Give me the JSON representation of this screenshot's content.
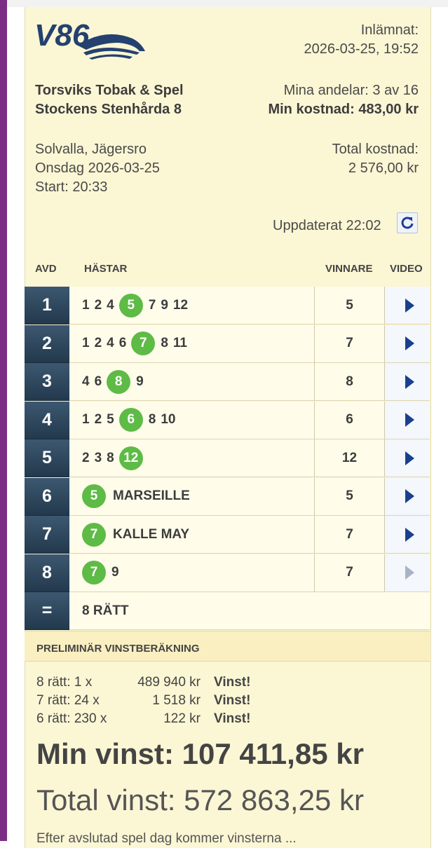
{
  "header": {
    "logo_text": "V86",
    "submitted_label": "Inlämnat:",
    "submitted_time": "2026-03-25, 19:52",
    "store_name": "Torsviks Tobak & Spel",
    "team_name": "Stockens Stenhårda 8",
    "shares": "Mina andelar: 3 av 16",
    "my_cost": "Min kostnad: 483,00 kr",
    "tracks": "Solvalla, Jägersro",
    "date": "Onsdag 2026-03-25",
    "start": "Start: 20:33",
    "total_cost_label": "Total kostnad:",
    "total_cost_value": "2 576,00 kr",
    "updated": "Uppdaterat 22:02",
    "refresh_icon": "refresh-icon"
  },
  "table": {
    "columns": {
      "avd": "AVD",
      "horses": "HÄSTAR",
      "winner": "VINNARE",
      "video": "VIDEO"
    },
    "rows": [
      {
        "avd": "1",
        "before": [
          "1",
          "2",
          "4"
        ],
        "winner_mark": "5",
        "after": [
          "7",
          "9",
          "12"
        ],
        "name": "",
        "winner": "5",
        "video_active": true
      },
      {
        "avd": "2",
        "before": [
          "1",
          "2",
          "4",
          "6"
        ],
        "winner_mark": "7",
        "after": [
          "8",
          "11"
        ],
        "name": "",
        "winner": "7",
        "video_active": true
      },
      {
        "avd": "3",
        "before": [
          "4",
          "6"
        ],
        "winner_mark": "8",
        "after": [
          "9"
        ],
        "name": "",
        "winner": "8",
        "video_active": true
      },
      {
        "avd": "4",
        "before": [
          "1",
          "2",
          "5"
        ],
        "winner_mark": "6",
        "after": [
          "8",
          "10"
        ],
        "name": "",
        "winner": "6",
        "video_active": true
      },
      {
        "avd": "5",
        "before": [
          "2",
          "3",
          "8"
        ],
        "winner_mark": "12",
        "after": [],
        "name": "",
        "winner": "12",
        "video_active": true
      },
      {
        "avd": "6",
        "before": [],
        "winner_mark": "5",
        "after": [],
        "name": "MARSEILLE",
        "winner": "5",
        "video_active": true
      },
      {
        "avd": "7",
        "before": [],
        "winner_mark": "7",
        "after": [],
        "name": "KALLE MAY",
        "winner": "7",
        "video_active": true
      },
      {
        "avd": "8",
        "before": [],
        "winner_mark": "7",
        "after": [
          "9"
        ],
        "name": "",
        "winner": "7",
        "video_active": false
      }
    ],
    "summary_symbol": "=",
    "summary_text": "8 RÄTT"
  },
  "prelim": {
    "title": "PRELIMINÄR VINSTBERÄKNING",
    "lines": [
      {
        "label": "8 rätt: 1 x",
        "amount": "489 940 kr",
        "status": "Vinst!"
      },
      {
        "label": "7 rätt: 24 x",
        "amount": "1 518 kr",
        "status": "Vinst!"
      },
      {
        "label": "6 rätt: 230 x",
        "amount": "122 kr",
        "status": "Vinst!"
      }
    ],
    "my_win": "Min vinst: 107 411,85 kr",
    "total_win": "Total vinst: 572 863,25 kr",
    "cut_text": "Efter avslutad spel dag kommer vinsterna ..."
  },
  "colors": {
    "accent_purple": "#7b2d84",
    "card_bg": "#fbf6d4",
    "avd_bg": "#2d4559",
    "winner_green": "#5dbb46",
    "play_blue": "#1b3f8f"
  }
}
